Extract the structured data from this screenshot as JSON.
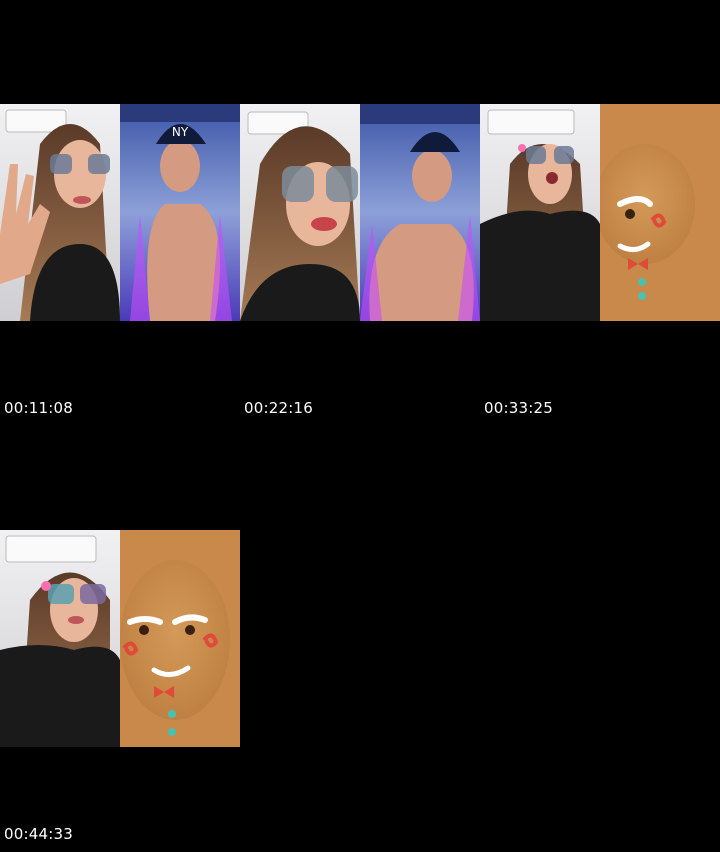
{
  "thumbnails": [
    {
      "timestamp": "00:11:08",
      "left_scene": "woman-waving",
      "right_scene": "man-purple-cap"
    },
    {
      "timestamp": "00:22:16",
      "left_scene": "woman-closeup",
      "right_scene": "man-purple-cap"
    },
    {
      "timestamp": "00:33:25",
      "left_scene": "woman-singing",
      "right_scene": "gingerbread-face"
    },
    {
      "timestamp": "00:44:33",
      "left_scene": "woman-sunglasses",
      "right_scene": "gingerbread-face"
    }
  ],
  "colors": {
    "background": "#000000",
    "room_wall": "#e6e6e8",
    "purple_stage": "#5a3fd0",
    "gingerbread": "#c8894a"
  }
}
